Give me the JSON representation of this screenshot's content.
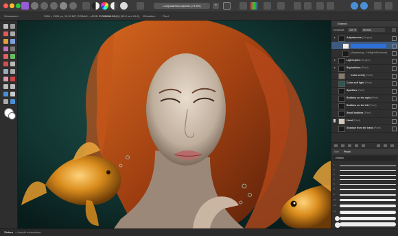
{
  "titlebar": {
    "document_title": "Langhaarfrisur.afphoto (73.8%)",
    "close_glyph": "×"
  },
  "contextbar": {
    "label_1": "Schwenken",
    "info_1": "3960 × 2951 px, 13.02 MP, RGBA/8 – sRGB IEC61966-2.1",
    "info_2": "CANON 5D(III) (50.0 mm f/1.8)",
    "label_units": "Einheiten:",
    "units_value": "Pixel"
  },
  "panel": {
    "tab_label": "Ebenen",
    "blend_label": "Deckkraft:",
    "opacity_value": "100 %",
    "blend_mode": "Normal",
    "layers": [
      {
        "name": "Adjustments",
        "type": "(Gruppe)"
      },
      {
        "name": "",
        "type": ""
      },
      {
        "name": "(Anpassung – Helligkeit/Kontrast)",
        "type": ""
      },
      {
        "name": "Light spots",
        "type": "(Gruppe)"
      },
      {
        "name": "Big bubbles",
        "type": "(Pixel)"
      },
      {
        "name": "Color overly",
        "type": "(Pixel)"
      },
      {
        "name": "Color soft light",
        "type": "(Pixel)"
      },
      {
        "name": "Sparkles",
        "type": "(Pixel)"
      },
      {
        "name": "Bubbles on the right",
        "type": "(Pixel)"
      },
      {
        "name": "Bubbles on the left",
        "type": "(Pixel)"
      },
      {
        "name": "Small bubbles",
        "type": "(Pixel)"
      },
      {
        "name": "Hand",
        "type": "(Pixel)"
      },
      {
        "name": "Shadow from the hand",
        "type": "(Pixel)"
      }
    ],
    "brush_tabs": [
      "Stile",
      "Pinsel"
    ],
    "brush_category": "Einfach",
    "brush_sizes": [
      "1",
      "2",
      "3",
      "4",
      "5",
      "6",
      "8",
      "10",
      "14",
      "16",
      "20",
      "24"
    ]
  },
  "status": {
    "action": "Ziehen",
    "hint": "= Ansicht schwenken."
  },
  "colors": {
    "accent_blue": "#2f6fd6",
    "selected_layer": "#3d5a80"
  }
}
